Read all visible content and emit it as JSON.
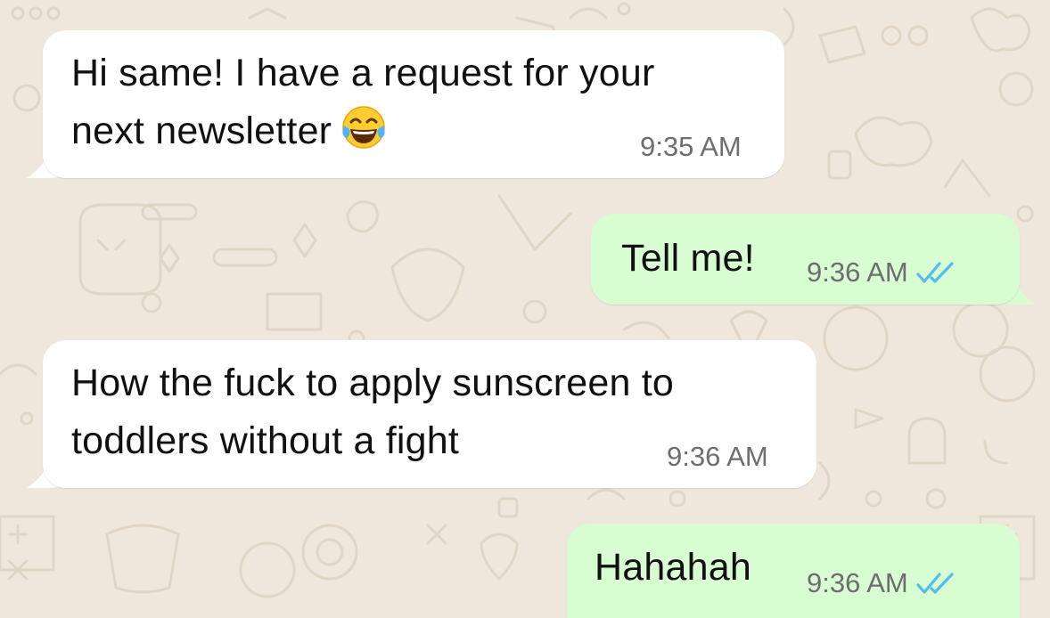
{
  "chat": {
    "messages": [
      {
        "direction": "incoming",
        "text": "Hi same! I have a request for your\nnext newsletter",
        "emoji": "face-with-tears-of-joy",
        "time": "9:35 AM"
      },
      {
        "direction": "outgoing",
        "text": "Tell me!",
        "time": "9:36 AM",
        "status": "read"
      },
      {
        "direction": "incoming",
        "text": "How the fuck to apply sunscreen to\ntoddlers without a fight",
        "time": "9:36 AM"
      },
      {
        "direction": "outgoing",
        "text": "Hahahah",
        "time": "9:36 AM",
        "status": "read"
      }
    ]
  },
  "colors": {
    "wallpaper": "#efe7dc",
    "incoming_bubble": "#ffffff",
    "outgoing_bubble": "#d9fdd3",
    "read_ticks": "#53bdeb"
  }
}
